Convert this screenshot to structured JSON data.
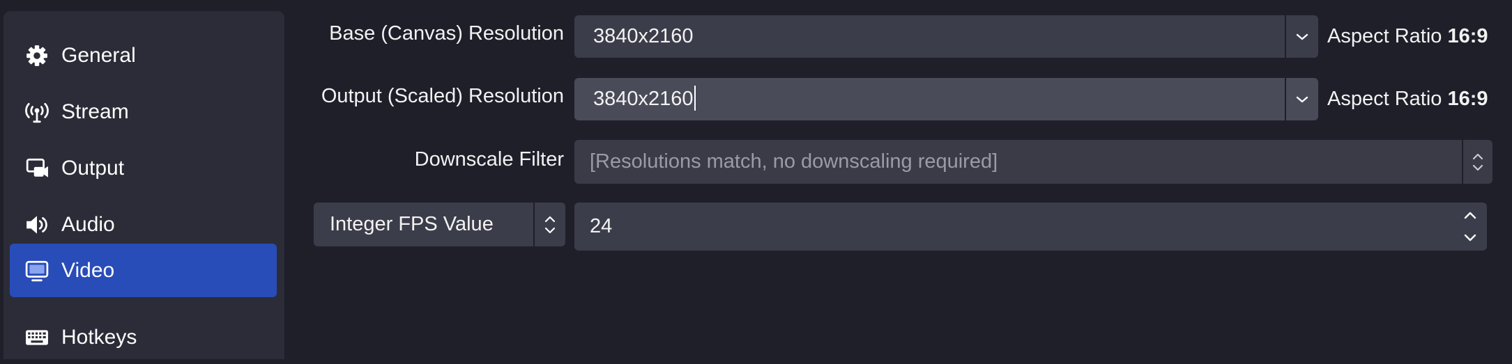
{
  "sidebar": {
    "items": [
      {
        "label": "General",
        "icon": "gear-icon"
      },
      {
        "label": "Stream",
        "icon": "antenna-icon"
      },
      {
        "label": "Output",
        "icon": "output-icon"
      },
      {
        "label": "Audio",
        "icon": "speaker-icon"
      },
      {
        "label": "Video",
        "icon": "monitor-icon",
        "active": true
      },
      {
        "label": "Hotkeys",
        "icon": "keyboard-icon"
      }
    ]
  },
  "video": {
    "base_resolution": {
      "label": "Base (Canvas) Resolution",
      "value": "3840x2160",
      "aspect_prefix": "Aspect Ratio",
      "aspect_value": "16:9"
    },
    "output_resolution": {
      "label": "Output (Scaled) Resolution",
      "value": "3840x2160",
      "aspect_prefix": "Aspect Ratio",
      "aspect_value": "16:9"
    },
    "downscale_filter": {
      "label": "Downscale Filter",
      "value": "[Resolutions match, no downscaling required]"
    },
    "fps": {
      "mode": "Integer FPS Value",
      "value": "24"
    }
  },
  "colors": {
    "background": "#1e1f29",
    "sidebar": "#2b2c37",
    "active_item": "#284cb8",
    "field": "#3c3d4a",
    "disabled_text": "#9a9ba6"
  }
}
